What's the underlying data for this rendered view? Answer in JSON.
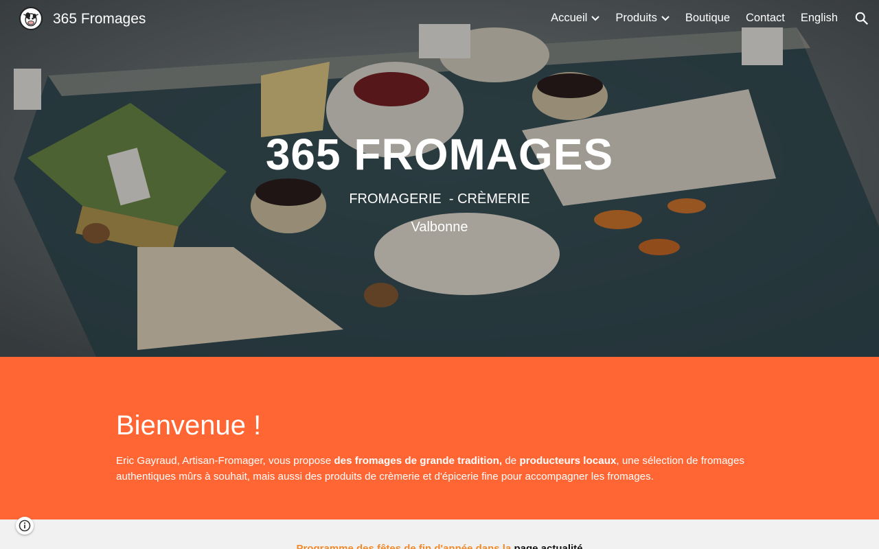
{
  "header": {
    "site_title": "365 Fromages",
    "menu": [
      {
        "label": "Accueil",
        "has_dropdown": true
      },
      {
        "label": "Produits",
        "has_dropdown": true
      },
      {
        "label": "Boutique",
        "has_dropdown": false
      },
      {
        "label": "Contact",
        "has_dropdown": false
      },
      {
        "label": "English",
        "has_dropdown": false
      }
    ],
    "search_icon": "search-icon",
    "logo_icon": "cow-logo-icon"
  },
  "hero": {
    "title": "365 FROMAGES",
    "subtitle": "FROMAGERIE  - CRÈMERIE",
    "location": "Valbonne"
  },
  "welcome": {
    "title": "Bienvenue !",
    "text_1": "Eric Gayraud, Artisan-Fromager, vous propose ",
    "bold_1": "des fromages de grande tradition,",
    "text_2": " de ",
    "bold_2": "producteurs locaux",
    "text_3": ", une sélection de fromages authentiques mûrs à souhait, mais aussi des produits de crèmerie et d'épicerie fine pour accompagner les fromages."
  },
  "announcement": {
    "text": "Programme des fêtes de fin d'année dans la ",
    "link_label": "page actualité"
  },
  "colors": {
    "accent": "#ff6633",
    "announcement_text": "#f08a2b",
    "page_background": "#f1f1f1"
  },
  "info_button_icon": "info-icon"
}
